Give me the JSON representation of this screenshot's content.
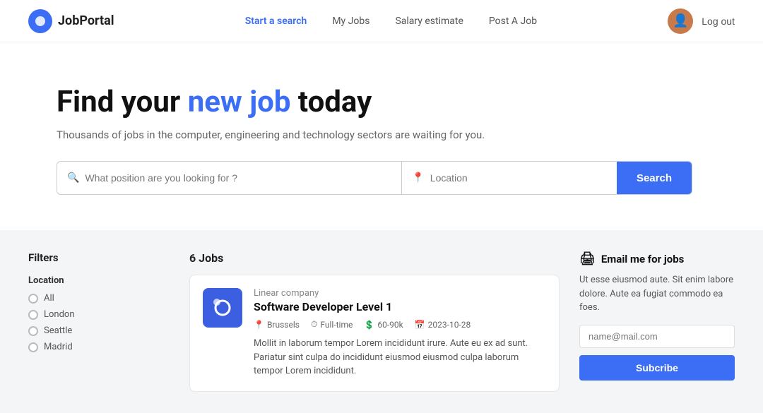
{
  "nav": {
    "logo_text": "JobPortal",
    "links": [
      {
        "id": "start-search",
        "label": "Start a search",
        "active": true
      },
      {
        "id": "my-jobs",
        "label": "My Jobs",
        "active": false
      },
      {
        "id": "salary-estimate",
        "label": "Salary estimate",
        "active": false
      },
      {
        "id": "post-job",
        "label": "Post A Job",
        "active": false
      }
    ],
    "logout_label": "Log out"
  },
  "hero": {
    "headline_start": "Find your ",
    "headline_highlight": "new job",
    "headline_end": " today",
    "subtext": "Thousands of jobs in the computer, engineering and technology sectors are waiting for you.",
    "position_placeholder": "What position are you looking for ?",
    "location_placeholder": "Location",
    "search_button": "Search"
  },
  "filters": {
    "title": "Filters",
    "location_label": "Location",
    "options": [
      {
        "label": "All"
      },
      {
        "label": "London"
      },
      {
        "label": "Seattle"
      },
      {
        "label": "Madrid"
      }
    ]
  },
  "jobs": {
    "count_label": "6 Jobs",
    "list": [
      {
        "company": "Linear company",
        "title": "Software Developer Level 1",
        "location": "Brussels",
        "type": "Full-time",
        "salary": "60-90k",
        "date": "2023-10-28",
        "description": "Mollit in laborum tempor Lorem incididunt irure. Aute eu ex ad sunt. Pariatur sint culpa do incididunt eiusmod eiusmod culpa laborum tempor Lorem incididunt."
      }
    ]
  },
  "email_section": {
    "title": "Email me for jobs",
    "description": "Ut esse eiusmod aute. Sit enim labore dolore. Aute ea fugiat commodo ea foes.",
    "input_placeholder": "name@mail.com",
    "button_label": "Subcribe"
  }
}
